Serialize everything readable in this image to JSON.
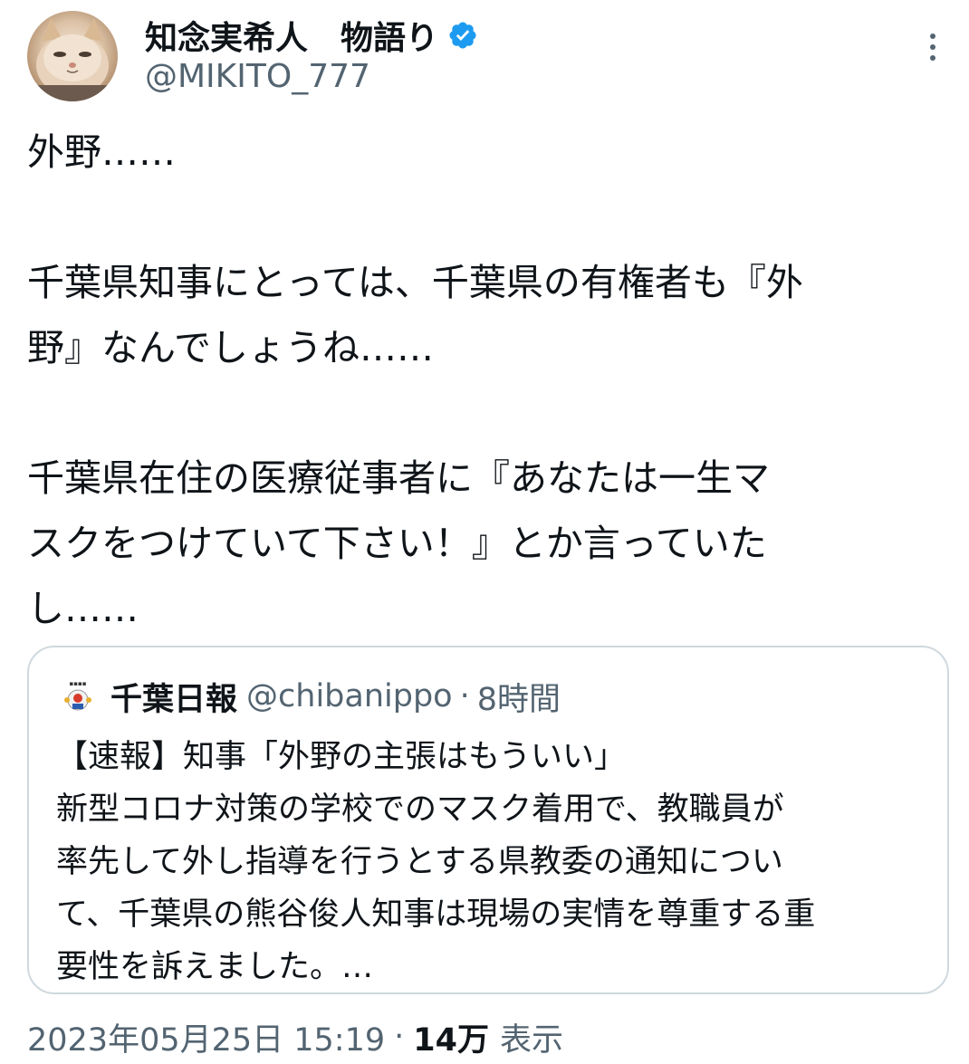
{
  "author": {
    "display_name": "知念実希人　物語り",
    "handle": "@MIKITO_777",
    "verified": true,
    "verified_color": "#1d9bf0"
  },
  "more_icon": "more-vertical-icon",
  "tweet": {
    "text": "外野……\n\n千葉県知事にとっては、千葉県の有権者も『外\n野』なんでしょうね……\n\n千葉県在住の医療従事者に『あなたは一生マ\nスクをつけていて下さい！』とか言っていた\nし……"
  },
  "quote": {
    "name": "千葉日報",
    "handle": "@chibanippo",
    "separator": "·",
    "time": "8時間",
    "body": "【速報】知事「外野の主張はもういい」\n新型コロナ対策の学校でのマスク着用で、教職員が\n率先して外し指導を行うとする県教委の通知につい\nて、千葉県の熊谷俊人知事は現場の実情を尊重する重\n要性を訴えました。…"
  },
  "meta": {
    "timestamp": "2023年05月25日 15:19",
    "separator": "·",
    "view_count": "14万",
    "view_label": "表示"
  }
}
